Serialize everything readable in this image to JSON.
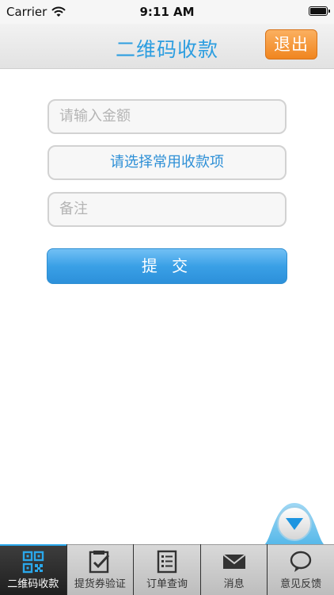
{
  "status_bar": {
    "carrier": "Carrier",
    "time": "9:11 AM"
  },
  "nav": {
    "title": "二维码收款",
    "logout_label": "退出"
  },
  "form": {
    "amount_placeholder": "请输入金额",
    "select_label": "请选择常用收款项",
    "note_placeholder": "备注",
    "submit_label": "提 交"
  },
  "tabs": [
    {
      "label": "二维码收款",
      "icon": "qr-code-icon",
      "active": true
    },
    {
      "label": "提货券验证",
      "icon": "clipboard-check-icon",
      "active": false
    },
    {
      "label": "订单查询",
      "icon": "document-list-icon",
      "active": false
    },
    {
      "label": "消息",
      "icon": "envelope-icon",
      "active": false
    },
    {
      "label": "意见反馈",
      "icon": "speech-bubble-icon",
      "active": false
    }
  ],
  "colors": {
    "accent_blue": "#2d9ee0",
    "logout_orange": "#f0851f",
    "tab_active_bg": "#2b2b2b"
  }
}
